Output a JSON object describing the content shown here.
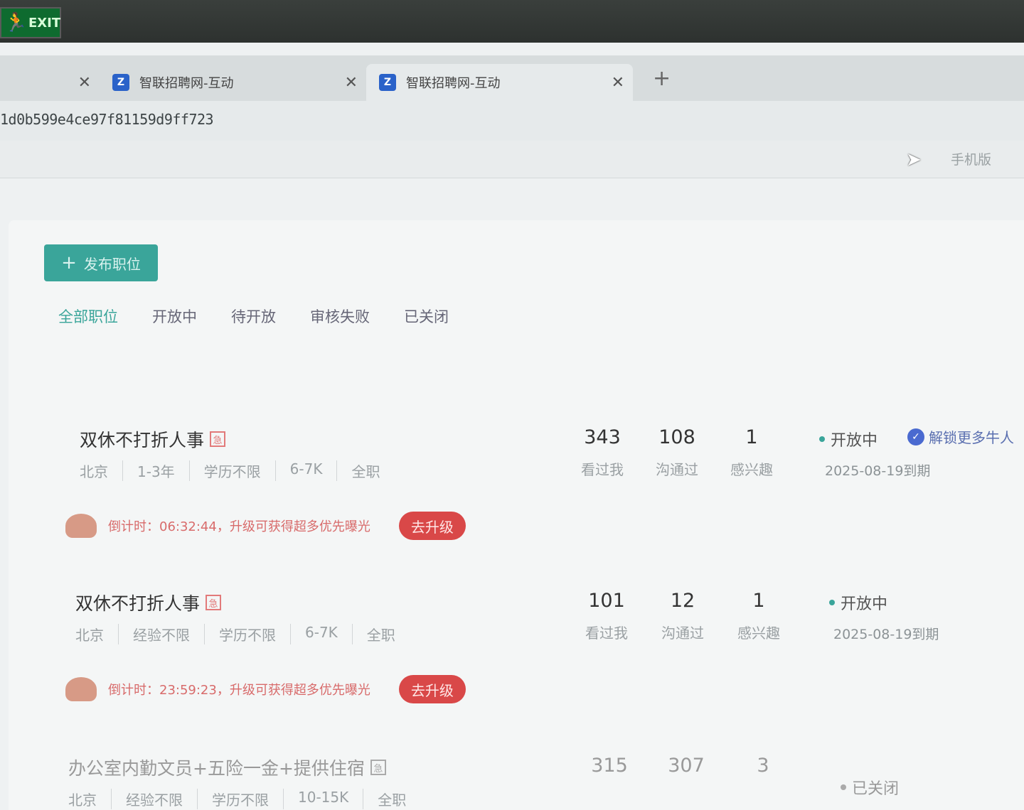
{
  "exit_sign": {
    "text": "EXIT"
  },
  "browser": {
    "tabs": [
      {
        "title": ""
      },
      {
        "title": "智联招聘网-互动"
      },
      {
        "title": "智联招聘网-互动"
      }
    ],
    "url": "1d0b599e4ce97f81159d9ff723",
    "new_tab": "+"
  },
  "site_header": {
    "mobile_link": "手机版"
  },
  "toolbar": {
    "publish_label": "发布职位"
  },
  "filter_tabs": [
    "全部职位",
    "开放中",
    "待开放",
    "审核失败",
    "已关闭"
  ],
  "stat_labels": [
    "看过我",
    "沟通过",
    "感兴趣"
  ],
  "jobs": [
    {
      "title": "双休不打折人事",
      "tag": "急",
      "meta": [
        "北京",
        "1-3年",
        "学历不限",
        "6-7K",
        "全职"
      ],
      "stats": [
        "343",
        "108",
        "1"
      ],
      "status": "开放中",
      "expire": "2025-08-19到期",
      "unlock": "解锁更多牛人",
      "promo": "倒计时：06:32:44，升级可获得超多优先曝光",
      "upgrade_label": "去升级"
    },
    {
      "title": "双休不打折人事",
      "tag": "急",
      "meta": [
        "北京",
        "经验不限",
        "学历不限",
        "6-7K",
        "全职"
      ],
      "stats": [
        "101",
        "12",
        "1"
      ],
      "status": "开放中",
      "expire": "2025-08-19到期",
      "promo": "倒计时：23:59:23，升级可获得超多优先曝光",
      "upgrade_label": "去升级"
    },
    {
      "title": "办公室内勤文员+五险一金+提供住宿",
      "tag": "急",
      "meta": [
        "北京",
        "经验不限",
        "学历不限",
        "10-15K",
        "全职"
      ],
      "stats": [
        "315",
        "307",
        "3"
      ],
      "status": "已关闭"
    }
  ]
}
